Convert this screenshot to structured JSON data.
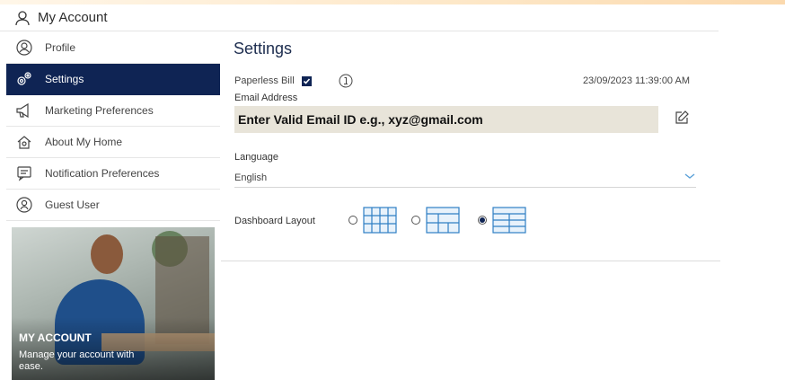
{
  "header": {
    "title": "My Account",
    "icon": "user-icon"
  },
  "sidebar": {
    "items": [
      {
        "label": "Profile",
        "icon": "profile-icon",
        "active": false
      },
      {
        "label": "Settings",
        "icon": "gears-icon",
        "active": true
      },
      {
        "label": "Marketing Preferences",
        "icon": "megaphone-icon",
        "active": false
      },
      {
        "label": "About My Home",
        "icon": "home-icon",
        "active": false
      },
      {
        "label": "Notification Preferences",
        "icon": "message-icon",
        "active": false
      },
      {
        "label": "Guest User",
        "icon": "guest-icon",
        "active": false
      }
    ],
    "promo": {
      "title": "MY ACCOUNT",
      "subtitle": "Manage your account with ease."
    }
  },
  "main": {
    "title": "Settings",
    "paperless_label": "Paperless Bill",
    "paperless_checked": true,
    "timestamp": "23/09/2023 11:39:00 AM",
    "email_label": "Email Address",
    "email_value": "Enter Valid Email ID e.g., xyz@gmail.com",
    "language_label": "Language",
    "language_value": "English",
    "layout_label": "Dashboard Layout",
    "layout_options": [
      {
        "icon": "grid-layout-icon",
        "selected": false
      },
      {
        "icon": "split-layout-icon",
        "selected": false
      },
      {
        "icon": "list-layout-icon",
        "selected": true
      }
    ]
  },
  "colors": {
    "accent": "#0f2454",
    "email_bg": "#e8e4d9",
    "layout_icon": "#2f7fc4"
  }
}
